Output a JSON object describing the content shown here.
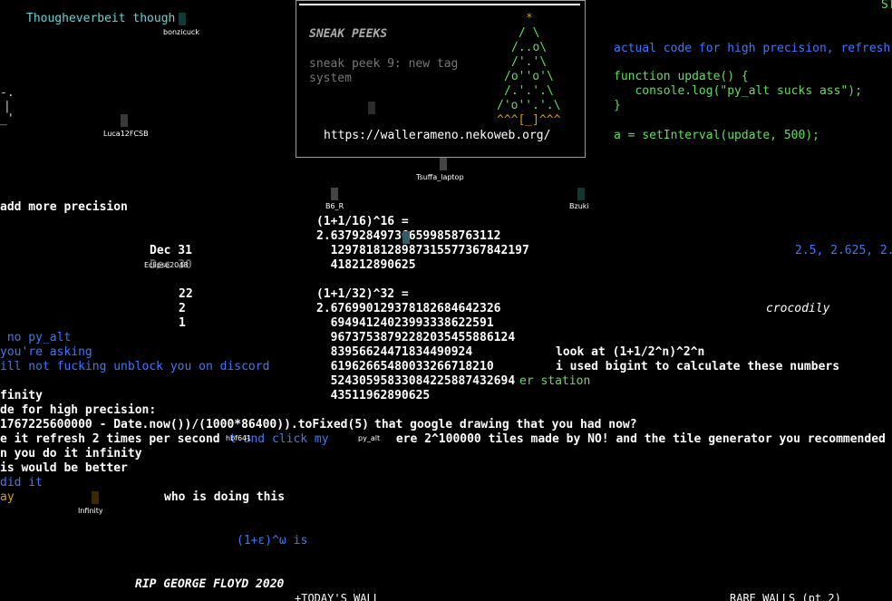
{
  "header": {
    "top_left_text": "Thougheverbeit though",
    "top_right_fragment": "ST"
  },
  "cursors": [
    {
      "name": "bonzicuck"
    },
    {
      "name": "Luca12FCSB"
    },
    {
      "name": "Tsuffa_laptop"
    },
    {
      "name": "B6_R"
    },
    {
      "name": "Bzuki"
    },
    {
      "name": "Eclipse2048"
    },
    {
      "name": "hbf641"
    },
    {
      "name": "py_alt"
    },
    {
      "name": "Infinity"
    }
  ],
  "sneak_panel": {
    "title": "SNEAK PEEKS",
    "peek_line1": "sneak peek 9: new tag",
    "peek_line2": "system",
    "url": "https://wallerameno.nekoweb.org/",
    "tree_lines": [
      "*",
      "/ \\",
      "/..o\\",
      "/'.'\\",
      "/o''o'\\",
      "/.'.'.\\",
      "/'o''.'.\\",
      "^^^[_]^^^"
    ]
  },
  "code_block": {
    "line1": "actual code for high precision, refresh",
    "line2": "function update() {",
    "line3": "   console.log(\"py_alt sucks ass\");",
    "line4": "}",
    "line5": "a = setInterval(update, 500);"
  },
  "math": {
    "title1": "(1+1/16)^16 =",
    "v1a": "2.637928497366599858763112",
    "v1b": "  1297818128987315577367842197",
    "v1c": "  418212890625",
    "title2": "(1+1/32)^32 =",
    "v2a": "2.676990129378182684642326",
    "v2b": "  69494124023993338622591",
    "v2c": "  96737538792282035455886124",
    "v2d": "  83956624471834490924",
    "v2e": "  61962665480033266718210",
    "v2f": "  52430595833084225887432694",
    "v2g": "  43511962890625",
    "er_station": "er station"
  },
  "notes": {
    "lookat": "look at (1+1/2^n)^2^n",
    "bigint": "i used bigint to calculate these numbers",
    "series": "2.5, 2.625, 2.",
    "crocodily": "crocodily",
    "add_precision": "add more precision",
    "dec31": "Dec 31",
    "dec30": "Dec 30",
    "n22": "22",
    "n2": "2",
    "n1": "1",
    "no_py_alt": " no py_alt",
    "youre_asking": "you're asking",
    "unblock": "ill not fucking unblock you on discord",
    "infinity_word": "finity",
    "high_prec": "de for high precision:",
    "formula": "1767225600000 - Date.now())/(1000*86400)).toFixed(5)",
    "google_drawing": "that google drawing that you had now?",
    "refresh2": "e it refresh 2 times per second",
    "click_my": "t and click my",
    "tiles": " ere 2^100000 tiles made by NO! and the tile generator you recommended",
    "do_it_inf": "n you do it infinity",
    "better": "is would be better",
    "did_it": "did it",
    "ay": "ay",
    "who_doing": "who is doing this",
    "epsilon": "(1+ε)^ω is",
    "rip": "RIP GEORGE FLOYD 2020"
  },
  "footer": {
    "todays_wall": "+TODAY'S WALL_____________________",
    "rare_walls": "RARE WALLS (pt 2)"
  }
}
